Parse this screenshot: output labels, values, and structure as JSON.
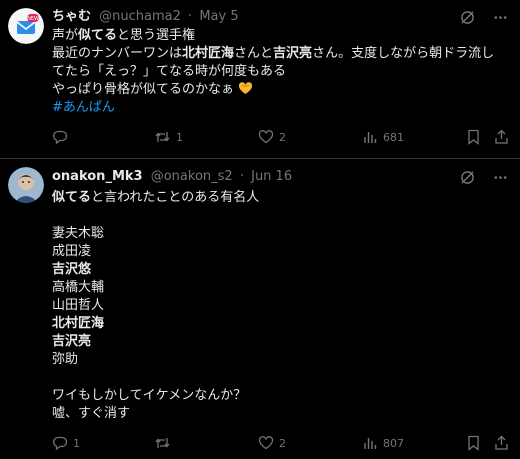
{
  "posts": [
    {
      "display_name": "ちゃむ",
      "handle": "@nuchama2",
      "separator": "·",
      "time": "May 5",
      "avatar_badge": "NEW",
      "lines": [
        [
          {
            "t": "声が"
          },
          {
            "t": "似てる",
            "b": true
          },
          {
            "t": "と思う選手権"
          }
        ],
        [
          {
            "t": "最近のナンバーワンは"
          },
          {
            "t": "北村匠海",
            "b": true
          },
          {
            "t": "さんと"
          },
          {
            "t": "吉沢亮",
            "b": true
          },
          {
            "t": "さん。支度しながら朝ドラ流し"
          }
        ],
        [
          {
            "t": "てたら「えっ？」てなる時が何度もある"
          }
        ],
        [
          {
            "t": "やっぱり骨格が似てるのかなぁ"
          }
        ]
      ],
      "hashtag": "#あんぱん",
      "stats": {
        "replies": "",
        "reposts": "1",
        "likes": "2",
        "views": "681"
      }
    },
    {
      "display_name": "onakon_Mk3",
      "handle": "@onakon_s2",
      "separator": "·",
      "time": "Jun 16",
      "lines": [
        [
          {
            "t": "似てる",
            "b": true
          },
          {
            "t": "と言われたことのある有名人"
          }
        ],
        [],
        [
          {
            "t": "妻夫木聡"
          }
        ],
        [
          {
            "t": "成田凌"
          }
        ],
        [
          {
            "t": "吉沢悠",
            "b": true
          }
        ],
        [
          {
            "t": "高橋大輔"
          }
        ],
        [
          {
            "t": "山田哲人"
          }
        ],
        [
          {
            "t": "北村匠海",
            "b": true
          }
        ],
        [
          {
            "t": "吉沢亮",
            "b": true
          }
        ],
        [
          {
            "t": "弥助"
          }
        ],
        [],
        [
          {
            "t": "ワイもしかしてイケメンなんか？"
          }
        ],
        [
          {
            "t": "嘘、すぐ消す"
          }
        ]
      ],
      "stats": {
        "replies": "1",
        "reposts": "",
        "likes": "2",
        "views": "807"
      }
    }
  ],
  "colors": {
    "background": "#000000",
    "text": "#e7e9ea",
    "muted": "#71767b",
    "link": "#1d9bf0",
    "divider": "#2f3336"
  },
  "icons": [
    "grok-icon",
    "more-icon",
    "reply-icon",
    "repost-icon",
    "like-icon",
    "views-icon",
    "bookmark-icon",
    "share-icon",
    "heart-hands-emoji"
  ]
}
